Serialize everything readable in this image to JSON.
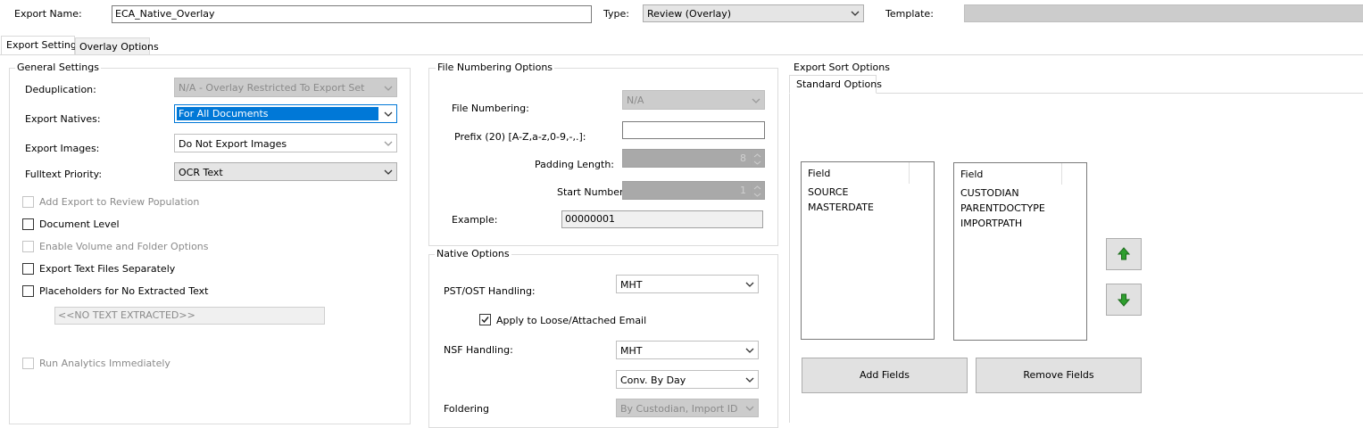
{
  "header": {
    "export_name_label": "Export Name:",
    "export_name_value": "ECA_Native_Overlay",
    "type_label": "Type:",
    "type_value": "Review (Overlay)",
    "template_label": "Template:",
    "template_value": ""
  },
  "tabs": [
    {
      "label": "Export Settings",
      "active": true
    },
    {
      "label": "Overlay Options",
      "active": false
    }
  ],
  "general": {
    "title": "General Settings",
    "dedup_label": "Deduplication:",
    "dedup_value": "N/A - Overlay Restricted To Export Set",
    "natives_label": "Export Natives:",
    "natives_value": "For All Documents",
    "images_label": "Export Images:",
    "images_value": "Do Not Export Images",
    "fulltext_label": "Fulltext Priority:",
    "fulltext_value": "OCR Text",
    "checkboxes": [
      {
        "label": "Add Export to Review Population",
        "checked": false,
        "enabled": false
      },
      {
        "label": "Document Level",
        "checked": false,
        "enabled": true
      },
      {
        "label": "Enable Volume and Folder Options",
        "checked": false,
        "enabled": false
      },
      {
        "label": "Export Text Files Separately",
        "checked": false,
        "enabled": true
      },
      {
        "label": "Placeholders for No Extracted Text",
        "checked": false,
        "enabled": true
      }
    ],
    "placeholder_text": "<<NO TEXT EXTRACTED>>",
    "run_analytics_label": "Run Analytics Immediately"
  },
  "numbering": {
    "title": "File Numbering Options",
    "file_numbering_label": "File Numbering:",
    "file_numbering_value": "N/A",
    "prefix_label": "Prefix (20) [A-Z,a-z,0-9,-,.]:",
    "prefix_value": "",
    "padding_label": "Padding Length:",
    "padding_value": "8",
    "start_label": "Start Number:",
    "start_value": "1",
    "example_label": "Example:",
    "example_value": "00000001"
  },
  "native": {
    "title": "Native Options",
    "pst_label": "PST/OST Handling:",
    "pst_value": "MHT",
    "apply_loose_label": "Apply to Loose/Attached Email",
    "apply_loose_checked": true,
    "nsf_label": "NSF Handling:",
    "nsf_value": "MHT",
    "conv_value": "Conv. By Day",
    "foldering_label": "Foldering",
    "foldering_value": "By Custodian, Import ID"
  },
  "sort": {
    "title": "Export Sort Options",
    "tab_label": "Standard Options",
    "left_header": "Field",
    "left_items": [
      "SOURCE",
      "MASTERDATE"
    ],
    "right_header": "Field",
    "right_items": [
      "CUSTODIAN",
      "PARENTDOCTYPE",
      "IMPORTPATH"
    ],
    "add_button": "Add Fields",
    "remove_button": "Remove Fields"
  },
  "colors": {
    "selection": "#0078d7",
    "arrow_green": "#2e9e2e"
  }
}
